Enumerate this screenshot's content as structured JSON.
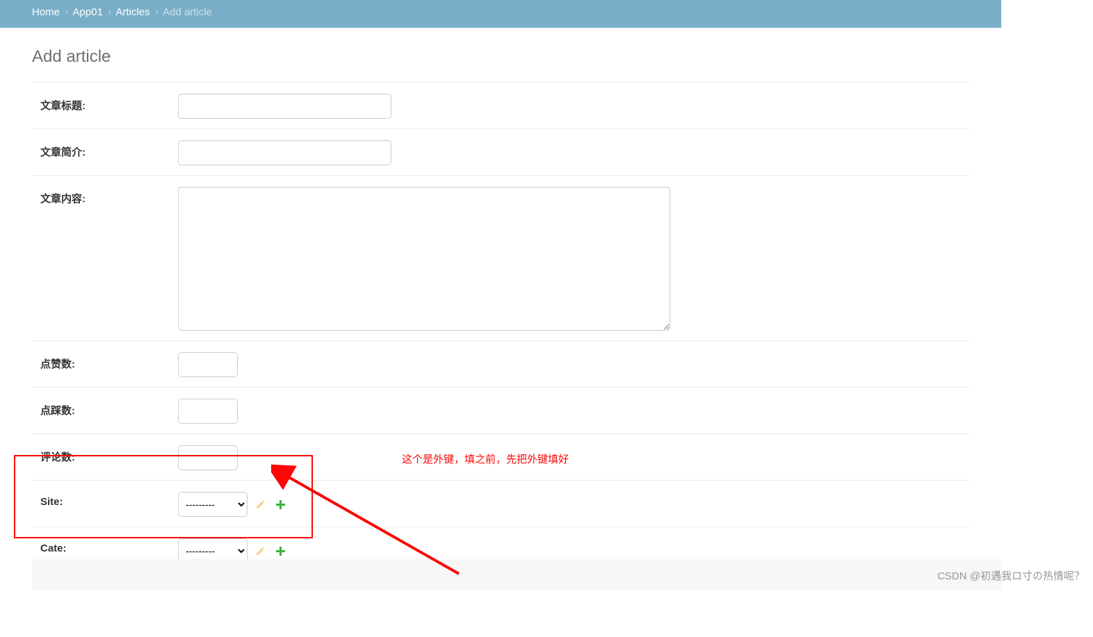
{
  "breadcrumb": {
    "home": "Home",
    "app": "App01",
    "model": "Articles",
    "current": "Add article"
  },
  "page": {
    "title": "Add article"
  },
  "fields": {
    "title_label": "文章标题:",
    "desc_label": "文章简介:",
    "content_label": "文章内容:",
    "up_label": "点赞数:",
    "down_label": "点踩数:",
    "comment_label": "评论数:",
    "site_label": "Site:",
    "cate_label": "Cate:",
    "fk_placeholder": "---------"
  },
  "annotation": {
    "text": "这个是外键，填之前，先把外键填好"
  },
  "watermark": "CSDN @初遇我ロ寸の热情呢？"
}
